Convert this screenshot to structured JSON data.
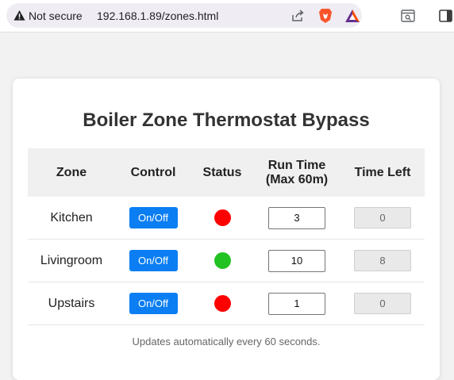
{
  "browser": {
    "security_label": "Not secure",
    "url": "192.168.1.89/zones.html",
    "icons": [
      "warning-icon",
      "share-icon",
      "brave-icon",
      "bat-rewards-icon",
      "reader-mode-icon",
      "sidebar-icon"
    ]
  },
  "page": {
    "title": "Boiler Zone Thermostat Bypass",
    "columns": [
      "Zone",
      "Control",
      "Status",
      "Run Time (Max 60m)",
      "Time Left"
    ],
    "columns_run_line1": "Run Time",
    "columns_run_line2": "(Max 60m)",
    "rows": [
      {
        "zone": "Kitchen",
        "control_label": "On/Off",
        "status": "off",
        "status_color": "#ff0000",
        "run_time": "3",
        "time_left": "0"
      },
      {
        "zone": "Livingroom",
        "control_label": "On/Off",
        "status": "on",
        "status_color": "#22c222",
        "run_time": "10",
        "time_left": "8"
      },
      {
        "zone": "Upstairs",
        "control_label": "On/Off",
        "status": "off",
        "status_color": "#ff0000",
        "run_time": "1",
        "time_left": "0"
      }
    ],
    "footer_note": "Updates automatically every 60 seconds."
  },
  "colors": {
    "button": "#0a7ef2",
    "status_on": "#22c222",
    "status_off": "#ff0000"
  }
}
